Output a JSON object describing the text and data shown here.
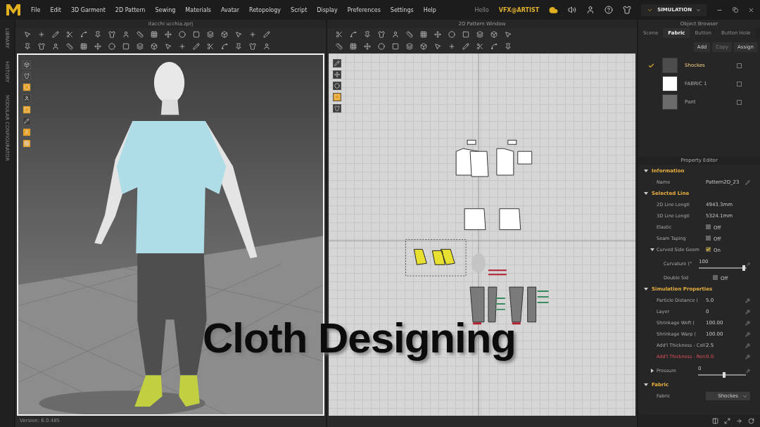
{
  "menu": [
    "File",
    "Edit",
    "3D Garment",
    "2D Pattern",
    "Sewing",
    "Materials",
    "Avatar",
    "Retopology",
    "Script",
    "Display",
    "Preferences",
    "Settings",
    "Help"
  ],
  "user": {
    "greeting": "Hello",
    "name": "VFX@ARTIST"
  },
  "mode": "SIMULATION",
  "side_tabs": [
    "LIBRARY",
    "HISTORY",
    "MODULAR CONFIGURATOR"
  ],
  "view3d": {
    "title": "itacchi ucchia.zprj",
    "version": "Version: 6.0.485"
  },
  "view2d": {
    "title": "2D Pattern Window"
  },
  "object_browser": {
    "title": "Object Browser",
    "tabs": [
      {
        "label": "Scene",
        "selected": false
      },
      {
        "label": "Fabric",
        "selected": true
      },
      {
        "label": "Button",
        "selected": false
      },
      {
        "label": "Button Hole",
        "selected": false
      }
    ],
    "actions": [
      {
        "label": "Add",
        "disabled": false
      },
      {
        "label": "Copy",
        "disabled": true
      },
      {
        "label": "Assign",
        "disabled": false
      }
    ],
    "fabrics": [
      {
        "name": "Shockes",
        "selected": true,
        "color": "#4c4c4c"
      },
      {
        "name": "FABRIC 1",
        "selected": false,
        "color": "#ffffff"
      },
      {
        "name": "Pant",
        "selected": false,
        "color": "#6b6b6b"
      }
    ]
  },
  "property_editor": {
    "title": "Property Editor",
    "sections": [
      {
        "title": "Information",
        "expanded": true,
        "rows": [
          {
            "kind": "text",
            "label": "Name",
            "value": "Pattern2D_23"
          }
        ]
      },
      {
        "title": "Selected Line",
        "expanded": true,
        "rows": [
          {
            "kind": "readout",
            "label": "2D Line Lengtl",
            "value": "4943.3mm"
          },
          {
            "kind": "readout",
            "label": "3D Line Lengtl",
            "value": "5324.1mm"
          },
          {
            "kind": "toggle",
            "label": "Elastic",
            "value": "Off",
            "checked": false
          },
          {
            "kind": "toggle",
            "label": "Seam Taping",
            "value": "Off",
            "checked": false
          },
          {
            "kind": "toggle",
            "label": "Curved Side Geom",
            "value": "On",
            "checked": true,
            "expanded": true,
            "children": [
              {
                "kind": "slider",
                "label": "Curvature (°",
                "value": "100",
                "level": 0.97
              },
              {
                "kind": "toggle",
                "label": "Double Sid",
                "value": "Off",
                "checked": false
              }
            ]
          }
        ]
      },
      {
        "title": "Simulation Properties",
        "expanded": true,
        "rows": [
          {
            "kind": "number",
            "label": "Particle Distance (",
            "value": "5.0"
          },
          {
            "kind": "number",
            "label": "Layer",
            "value": "0"
          },
          {
            "kind": "number",
            "label": "Shrinkage Weft (",
            "value": "100.00"
          },
          {
            "kind": "number",
            "label": "Shrinkage Warp (",
            "value": "100.00"
          },
          {
            "kind": "number",
            "label": "Add'l Thickness - Coll",
            "value": "2.5"
          },
          {
            "kind": "number",
            "label": "Add'l Thickness - Ren",
            "value": "0.0",
            "warning": true
          },
          {
            "kind": "slider",
            "label": "Pressure",
            "value": "0",
            "level": 0.55,
            "expanded": false
          }
        ]
      },
      {
        "title": "Fabric",
        "expanded": true,
        "rows": [
          {
            "kind": "dropdown",
            "label": "Fabric",
            "value": "Shockes"
          }
        ]
      }
    ]
  },
  "overlay_title": "Cloth Designing"
}
